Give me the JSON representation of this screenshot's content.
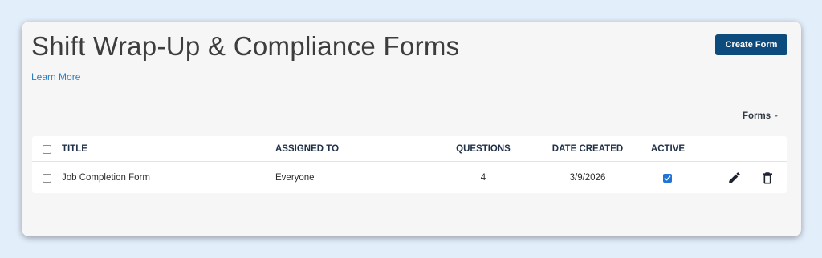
{
  "header": {
    "title": "Shift Wrap-Up & Compliance Forms",
    "learn_more": "Learn More",
    "create_button": "Create Form"
  },
  "filter": {
    "forms_dropdown": "Forms"
  },
  "table": {
    "columns": {
      "title": "TITLE",
      "assigned_to": "ASSIGNED TO",
      "questions": "QUESTIONS",
      "date_created": "DATE CREATED",
      "active": "ACTIVE"
    },
    "rows": [
      {
        "title": "Job Completion Form",
        "assigned_to": "Everyone",
        "questions": "4",
        "date_created": "3/9/2026",
        "active": true,
        "edit_icon": "pencil-icon",
        "delete_icon": "trash-icon"
      }
    ]
  },
  "colors": {
    "background": "#e3eefb",
    "card": "#f6f6f6",
    "primary_button": "#0d4b7c",
    "link": "#2c7ec3",
    "checkbox_active": "#1f74d6"
  }
}
